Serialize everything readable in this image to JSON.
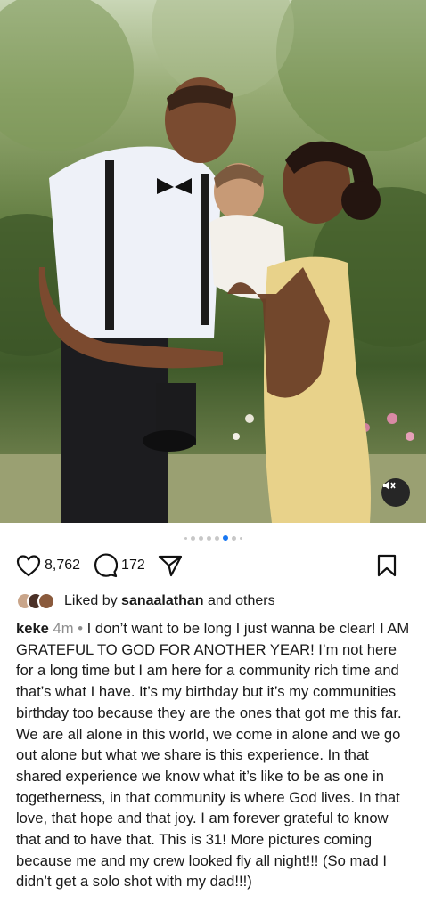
{
  "post": {
    "photo_description_icon": "family-photo",
    "mute_icon": "speaker-muted-icon",
    "carousel": {
      "total": 8,
      "active_index": 5
    }
  },
  "actions": {
    "like_count": "8,762",
    "comment_count": "172"
  },
  "liked_by": {
    "prefix": "Liked by",
    "user": "sanaalathan",
    "suffix": "and others"
  },
  "caption": {
    "username": "keke",
    "time": "4m",
    "separator": "•",
    "text": "I don’t want to be long I just wanna be clear! I AM GRATEFUL TO GOD FOR ANOTHER YEAR! I’m not here for a long time but I am here for a community rich time and that’s what I have. It’s my birthday but it’s my communities birthday too because they are the ones that got me this far. We are all alone in this world, we come in alone and we go out alone but what we share is this experience. In that shared experience we know what it’s like to be as one in togetherness, in that community is where God lives. In that love, that hope and that joy. I am forever grateful to know that and to have that. This is 31! More pictures coming because me and my crew looked fly all night!!! (So mad I didn’t get a solo shot with my dad!!!)"
  },
  "colors": {
    "accent": "#1877f2",
    "muted_text": "#8e8e8e",
    "dress": "#e8d28a"
  }
}
